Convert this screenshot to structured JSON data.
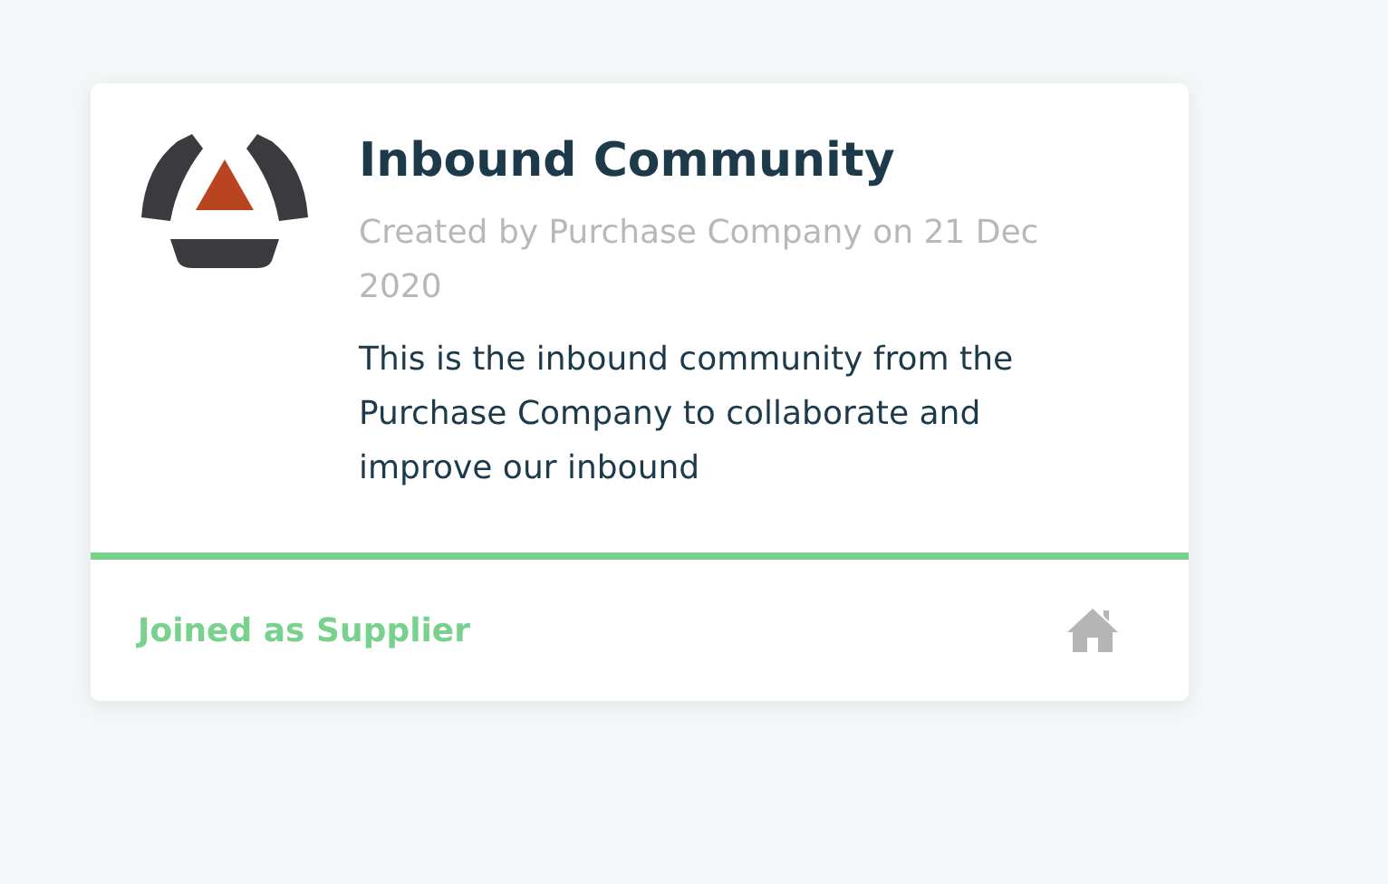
{
  "card": {
    "title": "Inbound Community",
    "meta": "Created by Purchase Company on 21 Dec 2020",
    "description": "This is the inbound community from the Purchase Company to collaborate and improve our inbound",
    "membership": "Joined as Supplier"
  }
}
